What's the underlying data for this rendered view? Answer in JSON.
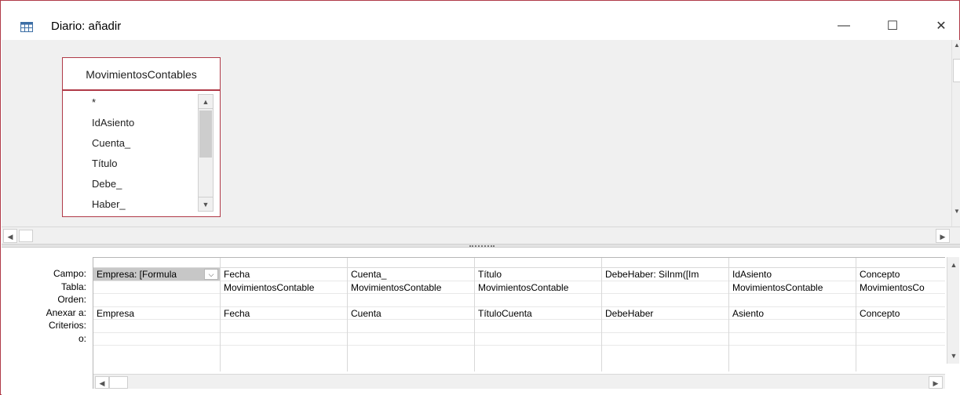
{
  "window": {
    "title": "Diario: añadir",
    "minimize_glyph": "—",
    "maximize_glyph": "☐",
    "close_glyph": "✕"
  },
  "table": {
    "name": "MovimientosContables",
    "fields": [
      "*",
      "IdAsiento",
      "Cuenta_",
      "Título",
      "Debe_",
      "Haber_"
    ]
  },
  "grid": {
    "row_labels": [
      "Campo:",
      "Tabla:",
      "Orden:",
      "Anexar a:",
      "Criterios:",
      "o:"
    ],
    "columns": [
      {
        "campo": "Empresa: [Formula",
        "tabla": "",
        "orden": "",
        "anexar": "Empresa",
        "criterios": "",
        "o": ""
      },
      {
        "campo": "Fecha",
        "tabla": "MovimientosContable",
        "orden": "",
        "anexar": "Fecha",
        "criterios": "",
        "o": ""
      },
      {
        "campo": "Cuenta_",
        "tabla": "MovimientosContable",
        "orden": "",
        "anexar": "Cuenta",
        "criterios": "",
        "o": ""
      },
      {
        "campo": "Título",
        "tabla": "MovimientosContable",
        "orden": "",
        "anexar": "TítuloCuenta",
        "criterios": "",
        "o": ""
      },
      {
        "campo": "DebeHaber: SiInm([Im",
        "tabla": "",
        "orden": "",
        "anexar": "DebeHaber",
        "criterios": "",
        "o": ""
      },
      {
        "campo": "IdAsiento",
        "tabla": "MovimientosContable",
        "orden": "",
        "anexar": "Asiento",
        "criterios": "",
        "o": ""
      },
      {
        "campo": "Concepto",
        "tabla": "MovimientosCo",
        "orden": "",
        "anexar": "Concepto",
        "criterios": "",
        "o": ""
      }
    ]
  },
  "colors": {
    "accent": "#b03a48",
    "pane_bg": "#f0f0f0",
    "selected_cell": "#c7c7c7"
  }
}
